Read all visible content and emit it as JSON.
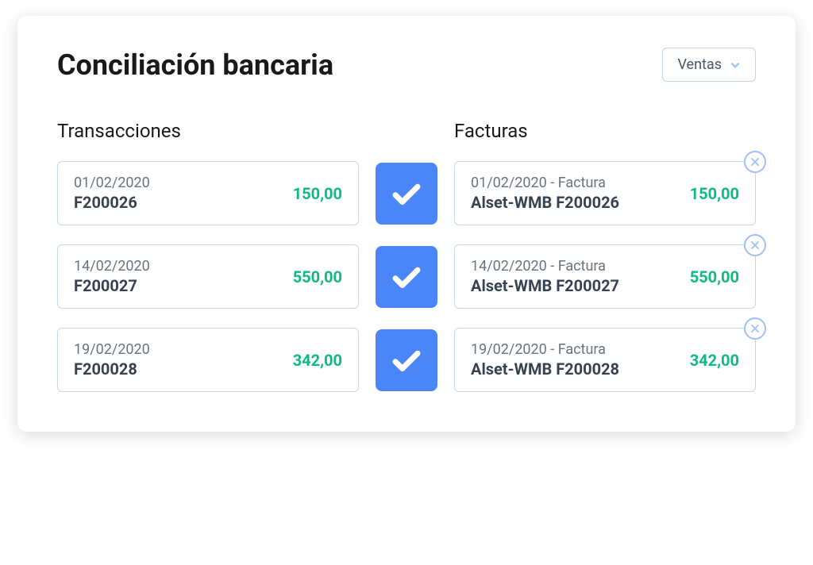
{
  "header": {
    "title": "Conciliación bancaria",
    "dropdown_label": "Ventas"
  },
  "columns": {
    "transactions_label": "Transacciones",
    "invoices_label": "Facturas"
  },
  "rows": [
    {
      "transaction": {
        "date": "01/02/2020",
        "ref": "F200026",
        "amount": "150,00"
      },
      "invoice": {
        "date_label": "01/02/2020 - Factura",
        "ref": "Alset-WMB F200026",
        "amount": "150,00"
      }
    },
    {
      "transaction": {
        "date": "14/02/2020",
        "ref": "F200027",
        "amount": "550,00"
      },
      "invoice": {
        "date_label": "14/02/2020 - Factura",
        "ref": "Alset-WMB F200027",
        "amount": "550,00"
      }
    },
    {
      "transaction": {
        "date": "19/02/2020",
        "ref": "F200028",
        "amount": "342,00"
      },
      "invoice": {
        "date_label": "19/02/2020 - Factura",
        "ref": "Alset-WMB F200028",
        "amount": "342,00"
      }
    }
  ],
  "colors": {
    "accent": "#4a86f7",
    "positive": "#10b981",
    "border": "#c5d5f0"
  }
}
